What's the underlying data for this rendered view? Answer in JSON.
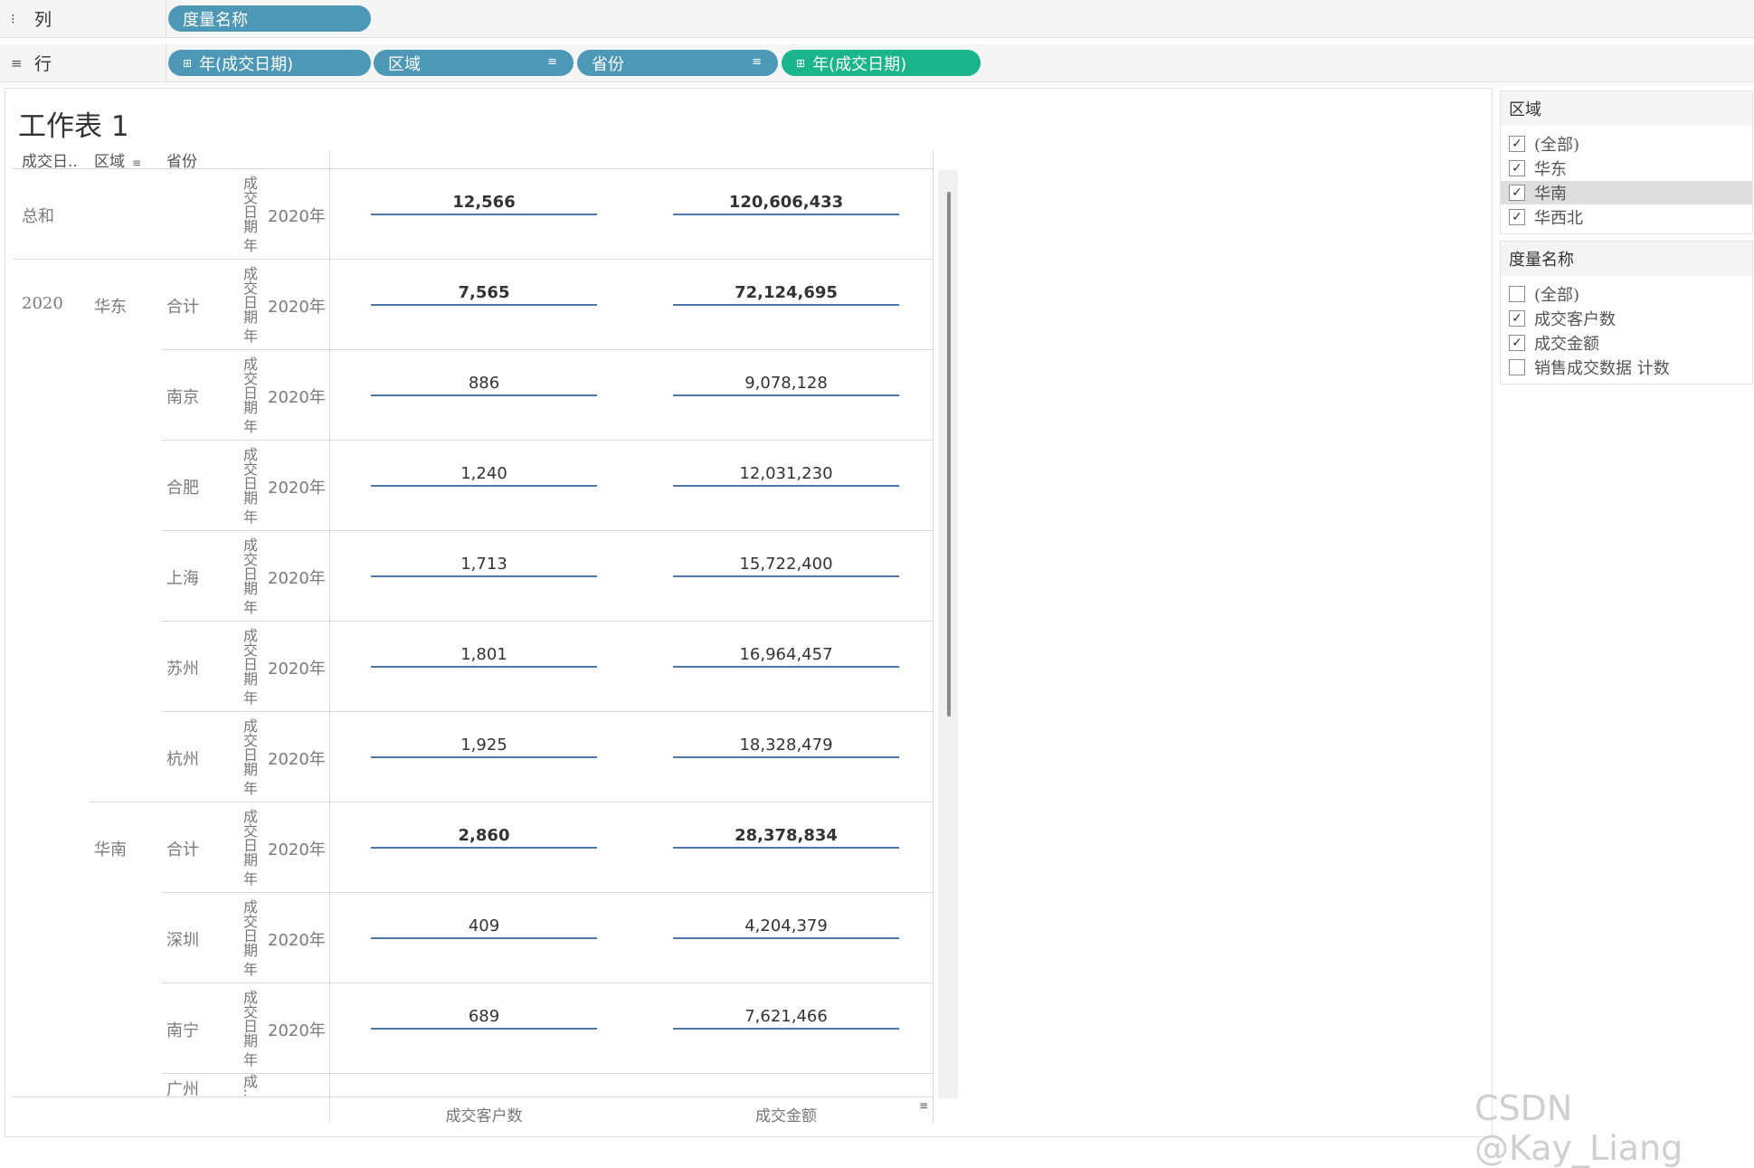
{
  "shelves": {
    "columns": {
      "label": "列",
      "pills": [
        "度量名称"
      ]
    },
    "rows": {
      "label": "行",
      "pills": [
        "年(成交日期)",
        "区域",
        "省份",
        "年(成交日期)"
      ]
    }
  },
  "sheet": {
    "title": "工作表 1",
    "headers": [
      "成交日..",
      "区域",
      "省份"
    ],
    "vlabel": "成交日期 年",
    "vlabel_short": "成...",
    "rows": [
      {
        "year_group": "",
        "region": "",
        "province": "总和",
        "year": "2020年",
        "customers": "12,566",
        "amount": "120,606,433",
        "bold": true
      },
      {
        "year_group": "2020",
        "region": "华东",
        "province": "合计",
        "year": "2020年",
        "customers": "7,565",
        "amount": "72,124,695",
        "bold": true
      },
      {
        "year_group": "",
        "region": "",
        "province": "南京",
        "year": "2020年",
        "customers": "886",
        "amount": "9,078,128",
        "bold": false
      },
      {
        "year_group": "",
        "region": "",
        "province": "合肥",
        "year": "2020年",
        "customers": "1,240",
        "amount": "12,031,230",
        "bold": false
      },
      {
        "year_group": "",
        "region": "",
        "province": "上海",
        "year": "2020年",
        "customers": "1,713",
        "amount": "15,722,400",
        "bold": false
      },
      {
        "year_group": "",
        "region": "",
        "province": "苏州",
        "year": "2020年",
        "customers": "1,801",
        "amount": "16,964,457",
        "bold": false
      },
      {
        "year_group": "",
        "region": "",
        "province": "杭州",
        "year": "2020年",
        "customers": "1,925",
        "amount": "18,328,479",
        "bold": false
      },
      {
        "year_group": "",
        "region": "华南",
        "province": "合计",
        "year": "2020年",
        "customers": "2,860",
        "amount": "28,378,834",
        "bold": true
      },
      {
        "year_group": "",
        "region": "",
        "province": "深圳",
        "year": "2020年",
        "customers": "409",
        "amount": "4,204,379",
        "bold": false
      },
      {
        "year_group": "",
        "region": "",
        "province": "南宁",
        "year": "2020年",
        "customers": "689",
        "amount": "7,621,466",
        "bold": false
      }
    ],
    "partial_province": "广州",
    "footer": [
      "成交客户数",
      "成交金额"
    ]
  },
  "filters": {
    "region": {
      "title": "区域",
      "options": [
        {
          "label": "(全部)",
          "checked": true,
          "highlight": false
        },
        {
          "label": "华东",
          "checked": true,
          "highlight": false
        },
        {
          "label": "华南",
          "checked": true,
          "highlight": true
        },
        {
          "label": "华西北",
          "checked": true,
          "highlight": false
        }
      ]
    },
    "measure": {
      "title": "度量名称",
      "options": [
        {
          "label": "(全部)",
          "checked": false,
          "highlight": false
        },
        {
          "label": "成交客户数",
          "checked": true,
          "highlight": false
        },
        {
          "label": "成交金额",
          "checked": true,
          "highlight": false
        },
        {
          "label": "销售成交数据 计数",
          "checked": false,
          "highlight": false
        }
      ]
    }
  },
  "watermark": "CSDN @Kay_Liang",
  "colors": {
    "pill_blue": "#4d97b7",
    "pill_green": "#1ab58a",
    "underline": "#4e79a7"
  }
}
